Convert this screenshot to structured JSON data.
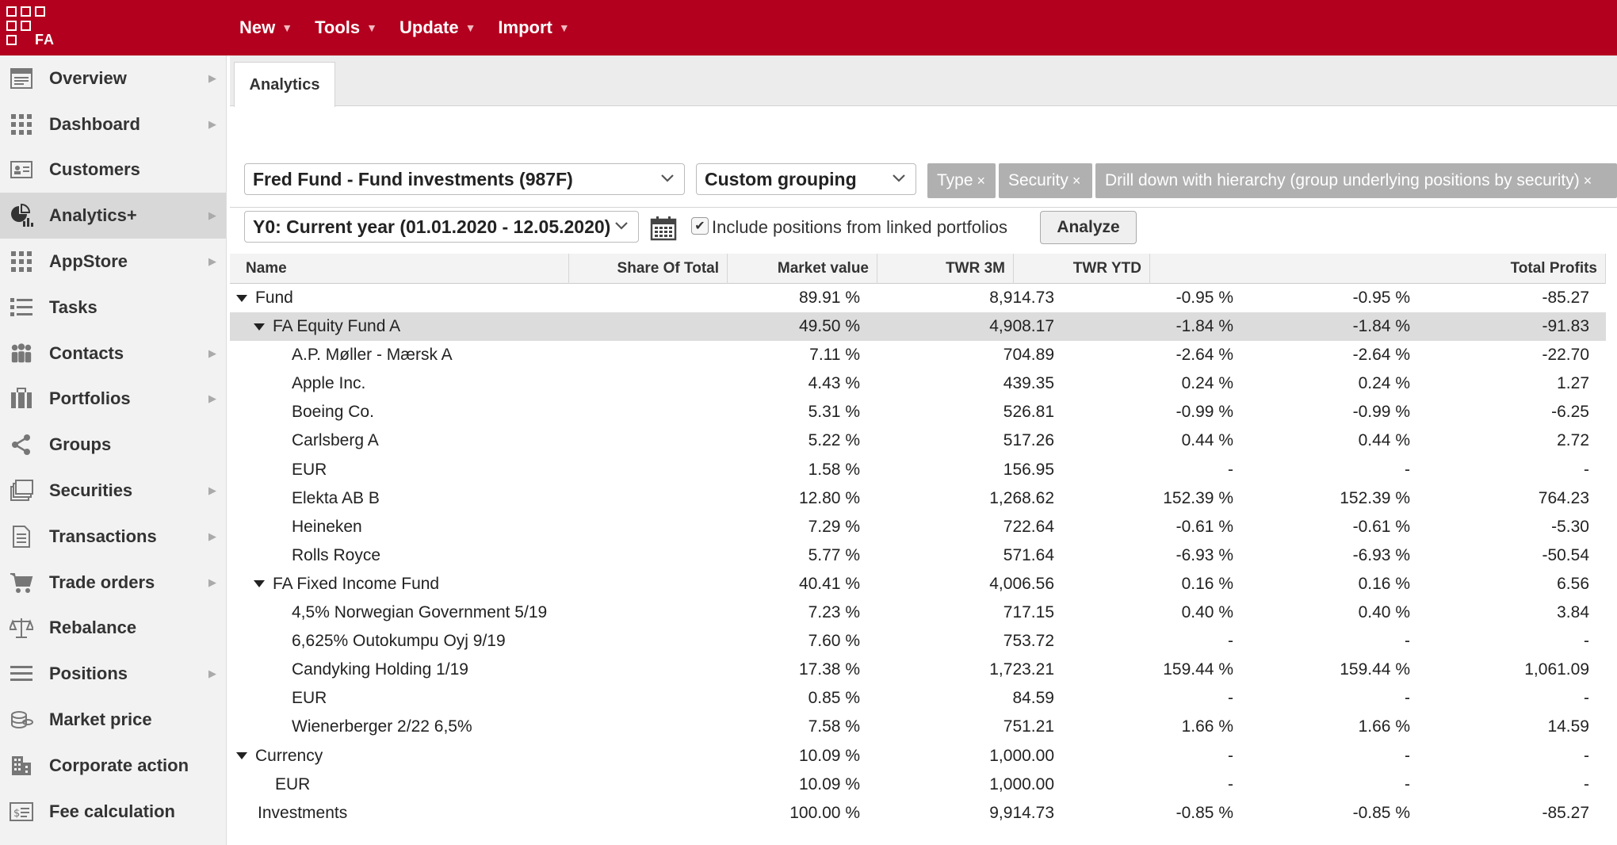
{
  "app": {
    "logo_text": "FA"
  },
  "menu": [
    {
      "label": "New"
    },
    {
      "label": "Tools"
    },
    {
      "label": "Update"
    },
    {
      "label": "Import"
    }
  ],
  "sidebar": {
    "items": [
      {
        "label": "Overview",
        "icon": "overview-icon",
        "arrow": true
      },
      {
        "label": "Dashboard",
        "icon": "dashboard-icon",
        "arrow": true
      },
      {
        "label": "Customers",
        "icon": "customers-icon",
        "arrow": false
      },
      {
        "label": "Analytics+",
        "icon": "analytics-icon",
        "arrow": true,
        "active": true
      },
      {
        "label": "AppStore",
        "icon": "appstore-icon",
        "arrow": true
      },
      {
        "label": "Tasks",
        "icon": "tasks-icon",
        "arrow": false
      },
      {
        "label": "Contacts",
        "icon": "contacts-icon",
        "arrow": true
      },
      {
        "label": "Portfolios",
        "icon": "portfolios-icon",
        "arrow": true
      },
      {
        "label": "Groups",
        "icon": "share-icon",
        "arrow": false
      },
      {
        "label": "Securities",
        "icon": "securities-icon",
        "arrow": true
      },
      {
        "label": "Transactions",
        "icon": "document-icon",
        "arrow": true
      },
      {
        "label": "Trade orders",
        "icon": "cart-icon",
        "arrow": true
      },
      {
        "label": "Rebalance",
        "icon": "scale-icon",
        "arrow": false
      },
      {
        "label": "Positions",
        "icon": "list-icon",
        "arrow": true
      },
      {
        "label": "Market price",
        "icon": "coins-icon",
        "arrow": false
      },
      {
        "label": "Corporate action",
        "icon": "building-icon",
        "arrow": false
      },
      {
        "label": "Fee calculation",
        "icon": "fee-icon",
        "arrow": false
      }
    ]
  },
  "tab": {
    "label": "Analytics"
  },
  "controls": {
    "portfolio": "Fred Fund - Fund investments (987F)",
    "grouping": "Custom grouping",
    "tags": [
      "Type",
      "Security",
      "Drill down with hierarchy (group underlying positions by security)"
    ],
    "period": "Y0: Current year (01.01.2020 - 12.05.2020)",
    "include_linked_label": "Include positions from linked portfolios",
    "include_linked_checked": true,
    "analyze_label": "Analyze"
  },
  "table": {
    "columns": [
      "Name",
      "Share Of Total",
      "Market value",
      "TWR 3M",
      "TWR YTD",
      "Total Profits"
    ],
    "rows": [
      {
        "level": 0,
        "expand": true,
        "name": "Fund",
        "share": "89.91 %",
        "mv": "8,914.73",
        "twr3m": "-0.95 %",
        "twrytd": "-0.95 %",
        "profits": "-85.27"
      },
      {
        "level": 1,
        "expand": true,
        "selected": true,
        "name": "FA Equity Fund A",
        "share": "49.50 %",
        "mv": "4,908.17",
        "twr3m": "-1.84 %",
        "twrytd": "-1.84 %",
        "profits": "-91.83"
      },
      {
        "level": 2,
        "name": "A.P. Møller - Mærsk A",
        "share": "7.11 %",
        "mv": "704.89",
        "twr3m": "-2.64 %",
        "twrytd": "-2.64 %",
        "profits": "-22.70"
      },
      {
        "level": 2,
        "name": "Apple Inc.",
        "share": "4.43 %",
        "mv": "439.35",
        "twr3m": "0.24 %",
        "twrytd": "0.24 %",
        "profits": "1.27"
      },
      {
        "level": 2,
        "name": "Boeing Co.",
        "share": "5.31 %",
        "mv": "526.81",
        "twr3m": "-0.99 %",
        "twrytd": "-0.99 %",
        "profits": "-6.25"
      },
      {
        "level": 2,
        "name": "Carlsberg A",
        "share": "5.22 %",
        "mv": "517.26",
        "twr3m": "0.44 %",
        "twrytd": "0.44 %",
        "profits": "2.72"
      },
      {
        "level": 2,
        "name": "EUR",
        "share": "1.58 %",
        "mv": "156.95",
        "twr3m": "-",
        "twrytd": "-",
        "profits": "-"
      },
      {
        "level": 2,
        "name": "Elekta AB B",
        "share": "12.80 %",
        "mv": "1,268.62",
        "twr3m": "152.39 %",
        "twrytd": "152.39 %",
        "profits": "764.23"
      },
      {
        "level": 2,
        "name": "Heineken",
        "share": "7.29 %",
        "mv": "722.64",
        "twr3m": "-0.61 %",
        "twrytd": "-0.61 %",
        "profits": "-5.30"
      },
      {
        "level": 2,
        "name": "Rolls Royce",
        "share": "5.77 %",
        "mv": "571.64",
        "twr3m": "-6.93 %",
        "twrytd": "-6.93 %",
        "profits": "-50.54"
      },
      {
        "level": 1,
        "expand": true,
        "name": "FA Fixed Income Fund",
        "share": "40.41 %",
        "mv": "4,006.56",
        "twr3m": "0.16 %",
        "twrytd": "0.16 %",
        "profits": "6.56"
      },
      {
        "level": 2,
        "name": "4,5% Norwegian Government 5/19",
        "share": "7.23 %",
        "mv": "717.15",
        "twr3m": "0.40 %",
        "twrytd": "0.40 %",
        "profits": "3.84"
      },
      {
        "level": 2,
        "name": "6,625% Outokumpu Oyj 9/19",
        "share": "7.60 %",
        "mv": "753.72",
        "twr3m": "-",
        "twrytd": "-",
        "profits": "-"
      },
      {
        "level": 2,
        "name": "Candyking Holding 1/19",
        "share": "17.38 %",
        "mv": "1,723.21",
        "twr3m": "159.44 %",
        "twrytd": "159.44 %",
        "profits": "1,061.09"
      },
      {
        "level": 2,
        "name": "EUR",
        "share": "0.85 %",
        "mv": "84.59",
        "twr3m": "-",
        "twrytd": "-",
        "profits": "-"
      },
      {
        "level": 2,
        "name": "Wienerberger 2/22 6,5%",
        "share": "7.58 %",
        "mv": "751.21",
        "twr3m": "1.66 %",
        "twrytd": "1.66 %",
        "profits": "14.59"
      },
      {
        "level": 0,
        "expand": true,
        "name": "Currency",
        "share": "10.09 %",
        "mv": "1,000.00",
        "twr3m": "-",
        "twrytd": "-",
        "profits": "-"
      },
      {
        "level": 1,
        "name": "EUR",
        "share": "10.09 %",
        "mv": "1,000.00",
        "twr3m": "-",
        "twrytd": "-",
        "profits": "-"
      },
      {
        "level": 0,
        "name": "Investments",
        "share": "100.00 %",
        "mv": "9,914.73",
        "twr3m": "-0.85 %",
        "twrytd": "-0.85 %",
        "profits": "-85.27"
      }
    ]
  },
  "colors": {
    "brand": "#b3001e",
    "tag_bg": "#b0b0b0",
    "selected_row": "#dcdcdc"
  }
}
